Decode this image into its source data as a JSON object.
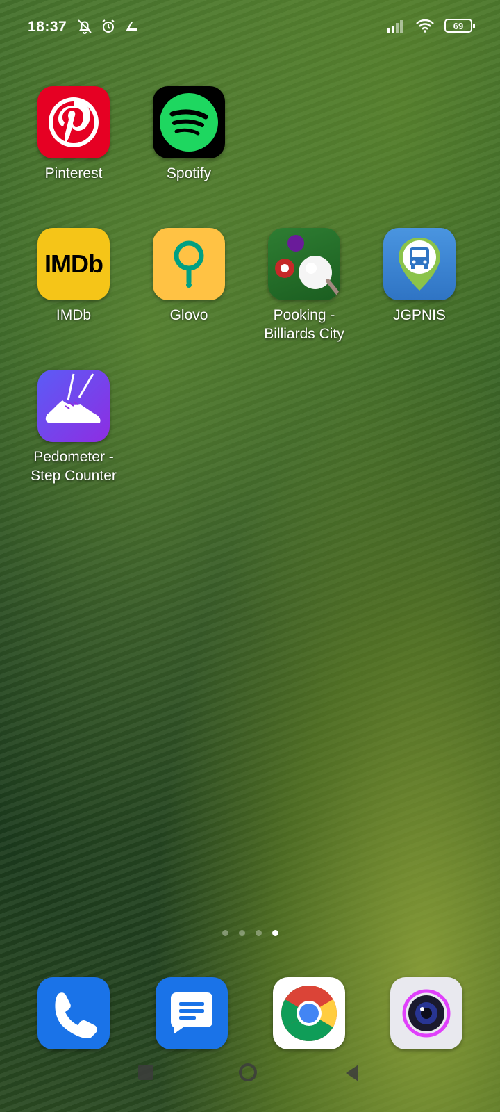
{
  "status_bar": {
    "time": "18:37",
    "battery": "69",
    "icons_left": [
      "mute-icon",
      "alarm-icon",
      "app-notification-icon"
    ],
    "icons_right": [
      "signal-icon",
      "wifi-icon",
      "battery-icon"
    ]
  },
  "apps": [
    {
      "label": "Pinterest",
      "icon": "pinterest-icon"
    },
    {
      "label": "Spotify",
      "icon": "spotify-icon"
    },
    {
      "label": "IMDb",
      "icon": "imdb-icon",
      "icon_text": "IMDb"
    },
    {
      "label": "Glovo",
      "icon": "glovo-icon"
    },
    {
      "label": "Pooking -\nBilliards City",
      "icon": "billiards-icon"
    },
    {
      "label": "JGPNIS",
      "icon": "bus-icon"
    },
    {
      "label": "Pedometer -\nStep Counter",
      "icon": "shoe-icon"
    }
  ],
  "page_indicator": {
    "count": 4,
    "active_index": 3
  },
  "dock": [
    {
      "name": "phone",
      "icon": "phone-icon"
    },
    {
      "name": "messages",
      "icon": "messages-icon"
    },
    {
      "name": "chrome",
      "icon": "chrome-icon"
    },
    {
      "name": "camera",
      "icon": "camera-icon"
    }
  ],
  "colors": {
    "pinterest": "#e60023",
    "spotify": "#1ed760",
    "imdb": "#f5c518",
    "glovo": "#ffc244",
    "glovo_pin": "#00a082",
    "jgpnis": "#3a85d8",
    "pedometer": "#7b2ff7",
    "phone": "#1a73e8",
    "messages": "#1a73e8"
  }
}
